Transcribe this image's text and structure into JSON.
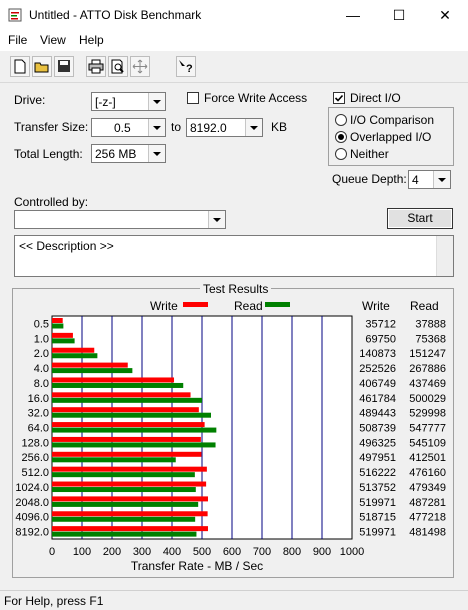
{
  "window": {
    "title": "Untitled - ATTO Disk Benchmark",
    "minimize": "—",
    "maximize": "☐",
    "close": "✕"
  },
  "menu": [
    "File",
    "View",
    "Help"
  ],
  "toolbar": {
    "icons": [
      "new-icon",
      "open-icon",
      "save-icon",
      "print-icon",
      "print-preview-icon",
      "move-icon",
      "help-icon"
    ]
  },
  "form": {
    "drive_label": "Drive:",
    "drive_value": "[-z-]",
    "transfer_size_label": "Transfer Size:",
    "transfer_from": "0.5",
    "to_label": "to",
    "transfer_to": "8192.0",
    "kb_label": "KB",
    "total_length_label": "Total Length:",
    "total_length_value": "256 MB",
    "force_write_label": "Force Write Access",
    "force_write_checked": false,
    "direct_io_label": "Direct I/O",
    "direct_io_checked": true,
    "io_options": [
      {
        "label": "I/O Comparison",
        "selected": false
      },
      {
        "label": "Overlapped I/O",
        "selected": true
      },
      {
        "label": "Neither",
        "selected": false
      }
    ],
    "queue_depth_label": "Queue Depth:",
    "queue_depth_value": "4",
    "controlled_by_label": "Controlled by:",
    "controlled_by_value": "",
    "start_label": "Start",
    "description": "<< Description >>"
  },
  "results": {
    "title": "Test Results",
    "write_legend": "Write",
    "read_legend": "Read",
    "write_col": "Write",
    "read_col": "Read",
    "x_axis_label": "Transfer Rate - MB / Sec",
    "write_color": "#ff0000",
    "read_color": "#008000"
  },
  "chart_data": {
    "type": "bar",
    "title": "Test Results",
    "xlabel": "Transfer Rate - MB / Sec",
    "ylabel": "",
    "xlim": [
      0,
      1000
    ],
    "ticks": [
      "0",
      "100",
      "200",
      "300",
      "400",
      "500",
      "600",
      "700",
      "800",
      "900",
      "1000"
    ],
    "categories": [
      "0.5",
      "1.0",
      "2.0",
      "4.0",
      "8.0",
      "16.0",
      "32.0",
      "64.0",
      "128.0",
      "256.0",
      "512.0",
      "1024.0",
      "2048.0",
      "4096.0",
      "8192.0"
    ],
    "series": [
      {
        "name": "Write",
        "color": "#ff0000",
        "values": [
          35712,
          69750,
          140873,
          252526,
          406749,
          461784,
          489443,
          508739,
          496325,
          497951,
          516222,
          513752,
          519971,
          518715,
          519971
        ]
      },
      {
        "name": "Read",
        "color": "#008000",
        "values": [
          37888,
          75368,
          151247,
          267886,
          437469,
          500029,
          529998,
          547777,
          545109,
          412501,
          476160,
          479349,
          487281,
          477218,
          481498
        ]
      }
    ],
    "value_unit_divisor": 1000
  },
  "status": {
    "text": "For Help, press F1"
  }
}
